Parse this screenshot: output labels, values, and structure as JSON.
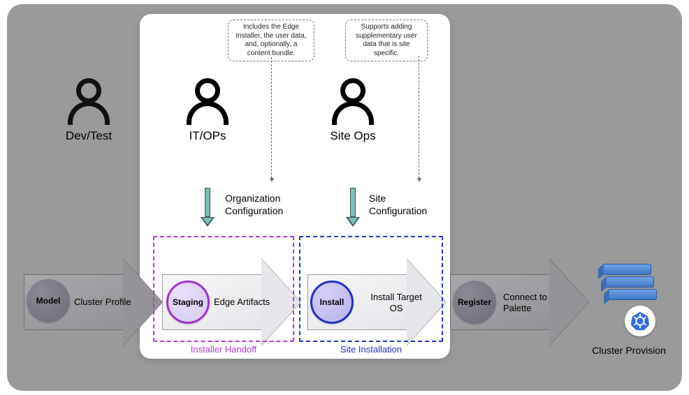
{
  "personas": {
    "devtest": "Dev/Test",
    "itops": "IT/OPs",
    "siteops": "Site Ops"
  },
  "callouts": {
    "itops": "Includes the Edge Installer, the user data, and, optionally, a content bundle.",
    "siteops": "Supports adding supplementary user data that is site specific."
  },
  "config_labels": {
    "org": "Organization\nConfiguration",
    "site": "Site\nConfiguration"
  },
  "stages": {
    "model": {
      "name": "Model",
      "output": "Cluster Profile"
    },
    "staging": {
      "name": "Staging",
      "output": "Edge Artifacts"
    },
    "install": {
      "name": "Install",
      "output": "Install Target\nOS"
    },
    "register": {
      "name": "Register",
      "output": "Connect to\nPalette"
    }
  },
  "phases": {
    "installer_handoff": "Installer Handoff",
    "site_installation": "Site Installation"
  },
  "result": "Cluster Provision"
}
